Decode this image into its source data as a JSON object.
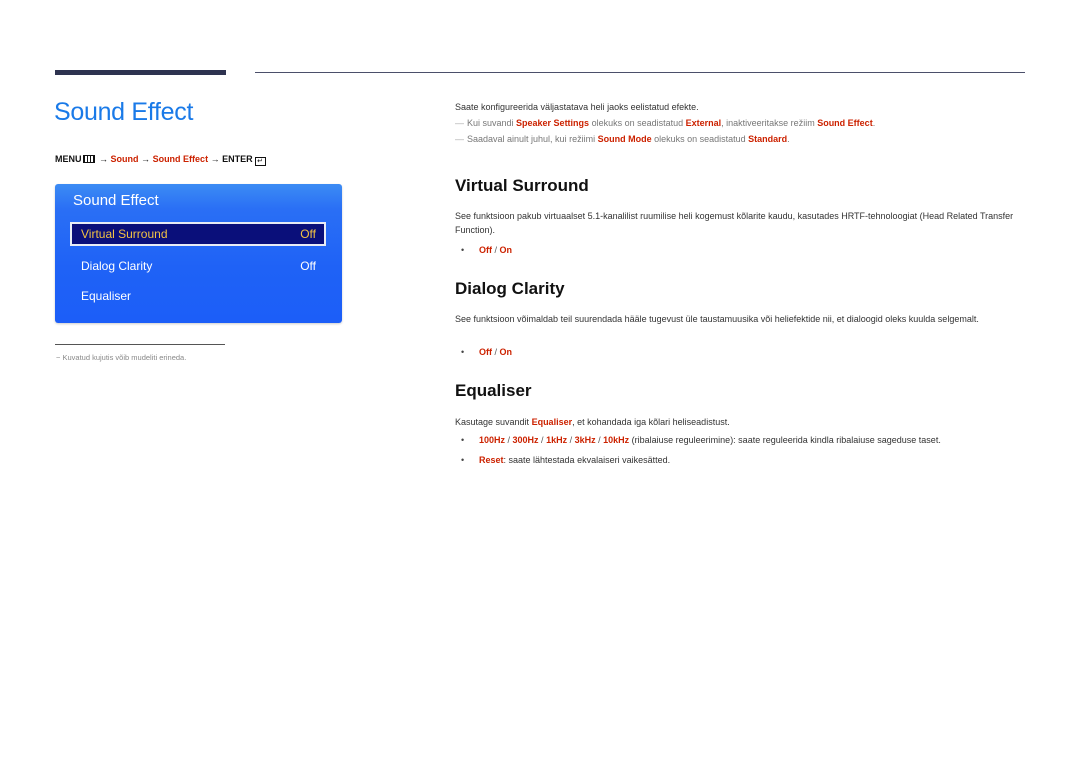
{
  "page": {
    "title": "Sound Effect",
    "menu_path": {
      "menu_label": "MENU",
      "arrow": "→",
      "items": [
        "Sound",
        "Sound Effect"
      ],
      "enter_label": "ENTER",
      "enter_glyph": "↵"
    }
  },
  "osd": {
    "title": "Sound Effect",
    "items": [
      {
        "label": "Virtual Surround",
        "value": "Off",
        "selected": true
      },
      {
        "label": "Dialog Clarity",
        "value": "Off",
        "selected": false
      },
      {
        "label": "Equaliser",
        "value": "",
        "selected": false
      }
    ]
  },
  "footnote": {
    "dash": "−",
    "text": "Kuvatud kujutis võib mudeliti erineda."
  },
  "intro": {
    "text": "Saate konfigureerida väljastatava heli jaoks eelistatud efekte.",
    "notes": [
      {
        "parts": [
          {
            "t": "Kui suvandi ",
            "em": false
          },
          {
            "t": "Speaker Settings",
            "em": true
          },
          {
            "t": " olekuks on seadistatud ",
            "em": false
          },
          {
            "t": "External",
            "em": true
          },
          {
            "t": ", inaktiveeritakse režiim ",
            "em": false
          },
          {
            "t": "Sound Effect",
            "em": true
          },
          {
            "t": ".",
            "em": false
          }
        ]
      },
      {
        "parts": [
          {
            "t": "Saadaval ainult juhul, kui režiimi ",
            "em": false
          },
          {
            "t": "Sound Mode",
            "em": true
          },
          {
            "t": " olekuks on seadistatud ",
            "em": false
          },
          {
            "t": "Standard",
            "em": true
          },
          {
            "t": ".",
            "em": false
          }
        ]
      }
    ]
  },
  "sections": {
    "virtual_surround": {
      "title": "Virtual Surround",
      "description": "See funktsioon pakub virtuaalset 5.1-kanalilist ruumilise heli kogemust kõlarite kaudu, kasutades HRTF-tehnoloogiat (Head Related Transfer Function).",
      "options": [
        "Off",
        "On"
      ]
    },
    "dialog_clarity": {
      "title": "Dialog Clarity",
      "description": "See funktsioon võimaldab teil suurendada hääle tugevust üle taustamuusika või heliefektide nii, et dialoogid oleks kuulda selgemalt.",
      "options": [
        "Off",
        "On"
      ]
    },
    "equaliser": {
      "title": "Equaliser",
      "description_pre": "Kasutage suvandit ",
      "description_em": "Equaliser",
      "description_post": ", et kohandada iga kõlari heliseadistust.",
      "bands": [
        "100Hz",
        "300Hz",
        "1kHz",
        "3kHz",
        "10kHz"
      ],
      "bands_text": " (ribalaiuse reguleerimine): saate reguleerida kindla ribalaiuse sageduse taset.",
      "reset_label": "Reset",
      "reset_text": ": saate lähtestada ekvalaiseri vaikesätted."
    }
  },
  "colors": {
    "title_blue": "#1a7ae8",
    "emphasis_red": "#cc2200",
    "osd_blue": "#1f62f6",
    "osd_selected_bg": "#0a0f7a",
    "osd_selected_text": "#f2c244"
  }
}
